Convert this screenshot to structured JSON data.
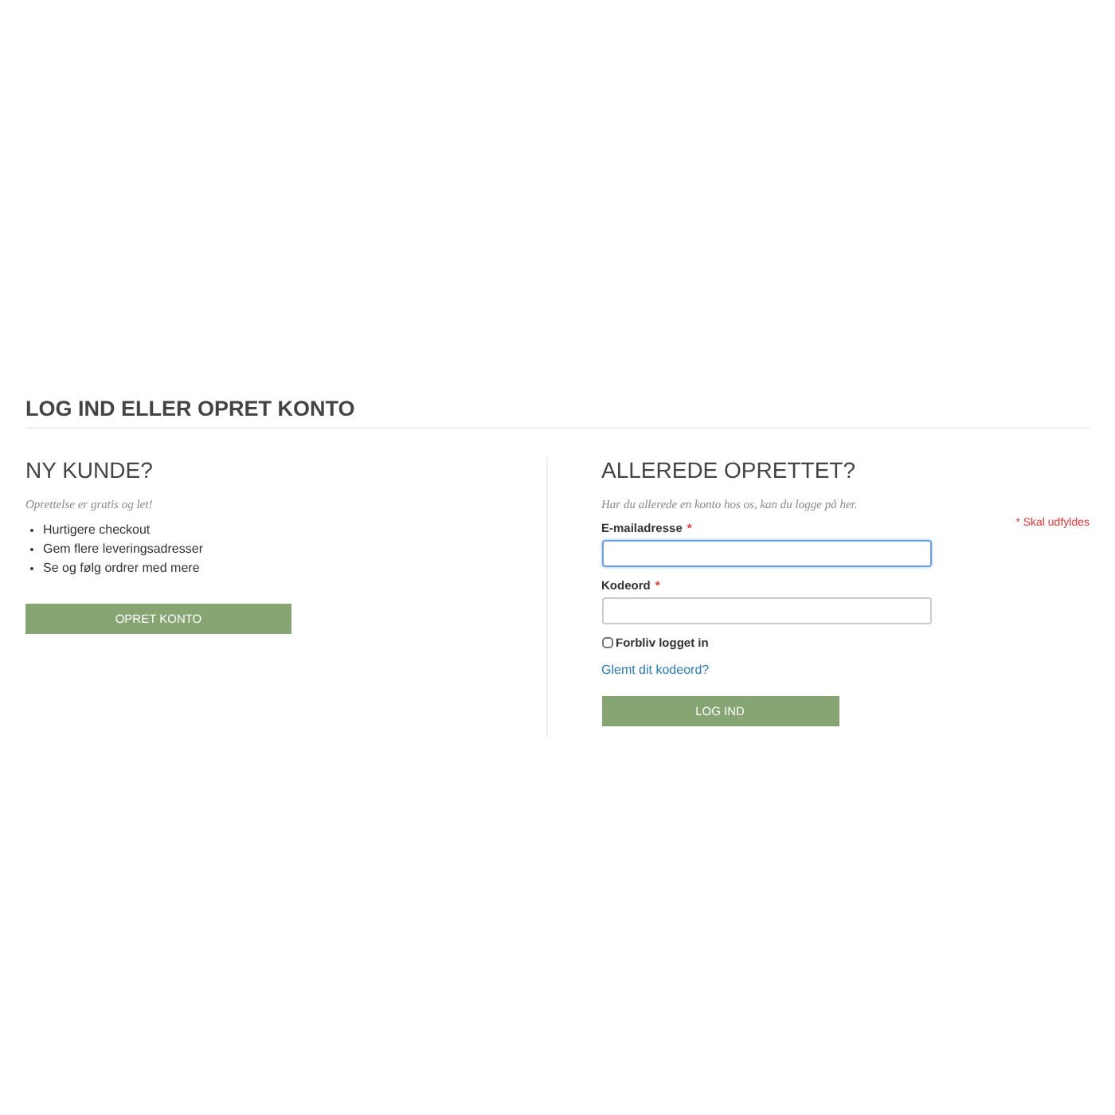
{
  "page_title": "LOG IND ELLER OPRET KONTO",
  "new_customer": {
    "heading": "NY KUNDE?",
    "intro": "Oprettelse er gratis og let!",
    "benefits": [
      "Hurtigere checkout",
      "Gem flere leveringsadresser",
      "Se og følg ordrer med mere"
    ],
    "button": "OPRET KONTO"
  },
  "existing_customer": {
    "heading": "ALLEREDE OPRETTET?",
    "intro": "Har du allerede en konto hos os, kan du logge på her.",
    "required_note": "* Skal udfyldes",
    "fields": [
      {
        "label": "E-mailadresse",
        "required_mark": "*",
        "focused": true
      },
      {
        "label": "Kodeord",
        "required_mark": "*",
        "focused": false
      }
    ],
    "remember": {
      "label": "Forbliv logget in",
      "checked": false
    },
    "forgot_link": "Glemt dit kodeord?",
    "button": "LOG IND"
  }
}
